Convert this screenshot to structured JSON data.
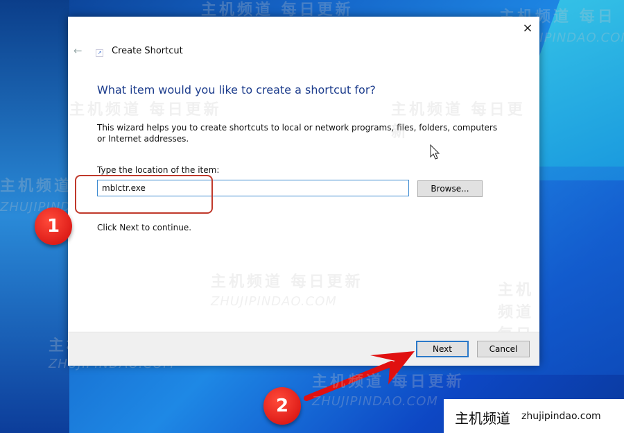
{
  "dialog": {
    "title": "Create Shortcut",
    "close_icon": "×",
    "back_icon": "←",
    "app_icon": "↗",
    "heading": "What item would you like to create a shortcut for?",
    "description": "This wizard helps you to create shortcuts to local or network programs, files, folders, computers or Internet addresses.",
    "location_label": "Type the location of the item:",
    "location_value": "mblctr.exe",
    "browse_label": "Browse...",
    "hint": "Click Next to continue.",
    "next_label": "Next",
    "cancel_label": "Cancel"
  },
  "annotations": {
    "step1": "1",
    "step2": "2",
    "accent_color": "#e01010"
  },
  "watermark": {
    "cn": "主机频道 每日更新",
    "en": "ZHUJIPINDAO.COM"
  },
  "brand": {
    "cn": "主机频道",
    "url": "zhujipindao.com"
  }
}
